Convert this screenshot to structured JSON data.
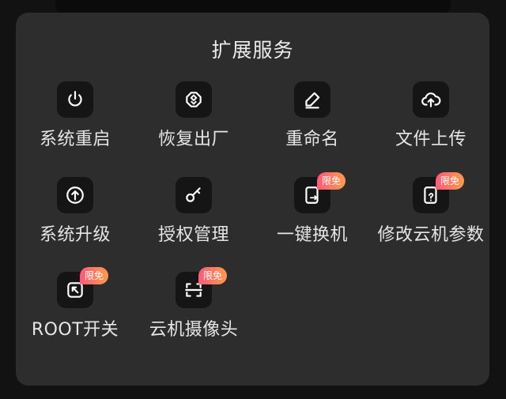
{
  "panel": {
    "title": "扩展服务"
  },
  "badge_color_start": "#ff5a7a",
  "badge_color_end": "#ff9a4a",
  "items": [
    {
      "label": "系统重启",
      "icon": "power-icon"
    },
    {
      "label": "恢复出厂",
      "icon": "reset-icon"
    },
    {
      "label": "重命名",
      "icon": "pencil-icon"
    },
    {
      "label": "文件上传",
      "icon": "cloud-upload-icon"
    },
    {
      "label": "系统升级",
      "icon": "arrow-up-circle-icon"
    },
    {
      "label": "授权管理",
      "icon": "key-icon"
    },
    {
      "label": "一键换机",
      "icon": "swap-device-icon",
      "badge": "限免"
    },
    {
      "label": "修改云机参数",
      "icon": "edit-params-icon",
      "badge": "限免"
    },
    {
      "label": "ROOT开关",
      "icon": "root-icon",
      "badge": "限免"
    },
    {
      "label": "云机摄像头",
      "icon": "camera-scan-icon",
      "badge": "限免"
    }
  ]
}
